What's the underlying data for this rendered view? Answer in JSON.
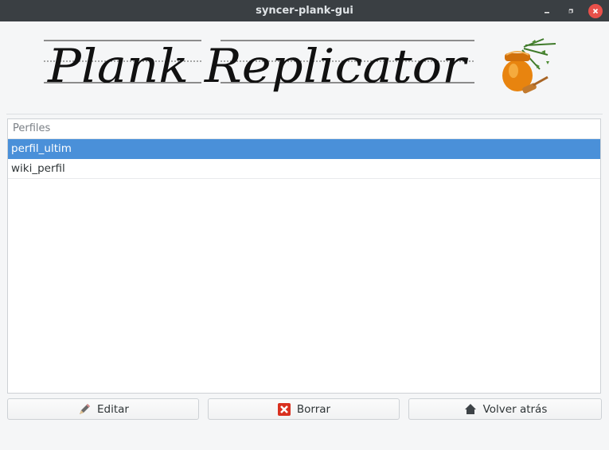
{
  "window": {
    "title": "syncer-plank-gui",
    "controls": {
      "minimize_icon": "minimize-icon",
      "maximize_icon": "maximize-icon",
      "close_icon": "close-icon"
    }
  },
  "banner": {
    "title": "Plank Replicator",
    "icon": "honey-pot-icon"
  },
  "profiles": {
    "header": "Perfiles",
    "items": [
      {
        "label": "perfil_ultim",
        "selected": true
      },
      {
        "label": "wiki_perfil",
        "selected": false
      }
    ]
  },
  "actions": {
    "edit": {
      "label": "Editar",
      "icon": "pencil-icon"
    },
    "delete": {
      "label": "Borrar",
      "icon": "delete-x-icon"
    },
    "back": {
      "label": "Volver atrás",
      "icon": "home-icon"
    }
  },
  "colors": {
    "titlebar": "#3a3f43",
    "selection": "#4a90d9",
    "close_button": "#e9504a",
    "delete_icon": "#d9301f"
  }
}
